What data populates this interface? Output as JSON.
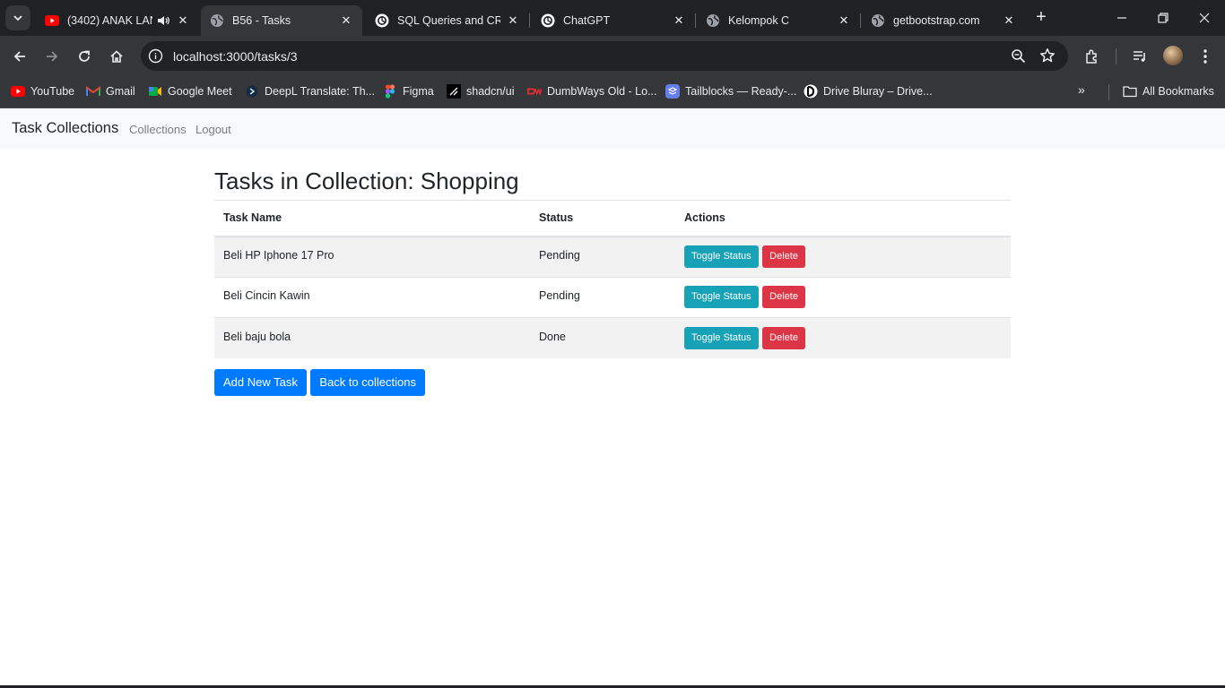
{
  "browser": {
    "tabs": [
      {
        "title": "(3402) ANAK LAN",
        "favicon": "youtube-icon",
        "active": false
      },
      {
        "title": "B56 - Tasks",
        "favicon": "globe-icon",
        "active": true
      },
      {
        "title": "SQL Queries and CRU",
        "favicon": "chatgpt-icon",
        "active": false
      },
      {
        "title": "ChatGPT",
        "favicon": "chatgpt-icon",
        "active": false
      },
      {
        "title": "Kelompok C",
        "favicon": "globe-icon",
        "active": false
      },
      {
        "title": "getbootstrap.com",
        "favicon": "globe-icon",
        "active": false
      }
    ],
    "address": "localhost:3000/tasks/3",
    "bookmarks": [
      {
        "label": "YouTube",
        "icon": "youtube-icon"
      },
      {
        "label": "Gmail",
        "icon": "gmail-icon"
      },
      {
        "label": "Google Meet",
        "icon": "meet-icon"
      },
      {
        "label": "DeepL Translate: Th...",
        "icon": "deepl-icon"
      },
      {
        "label": "Figma",
        "icon": "figma-icon"
      },
      {
        "label": "shadcn/ui",
        "icon": "shadcn-icon"
      },
      {
        "label": "DumbWays Old - Lo...",
        "icon": "dumbways-icon"
      },
      {
        "label": "Tailblocks — Ready-...",
        "icon": "tailblocks-icon"
      },
      {
        "label": "Drive Bluray – Drive...",
        "icon": "drive-bluray-icon"
      }
    ],
    "all_bookmarks": "All Bookmarks"
  },
  "app": {
    "brand": "Task Collections",
    "nav": [
      {
        "label": "Collections"
      },
      {
        "label": "Logout"
      }
    ],
    "heading": "Tasks in Collection: Shopping",
    "table": {
      "headers": [
        "Task Name",
        "Status",
        "Actions"
      ],
      "rows": [
        {
          "name": "Beli HP Iphone 17 Pro",
          "status": "Pending"
        },
        {
          "name": "Beli Cincin Kawin",
          "status": "Pending"
        },
        {
          "name": "Beli baju bola",
          "status": "Done"
        }
      ],
      "toggle_label": "Toggle Status",
      "delete_label": "Delete"
    },
    "add_task_label": "Add New Task",
    "back_label": "Back to collections"
  },
  "colors": {
    "primary": "#007bff",
    "info": "#17a2b8",
    "danger": "#dc3545",
    "chrome_dark": "#202124",
    "chrome_toolbar": "#35363a"
  }
}
